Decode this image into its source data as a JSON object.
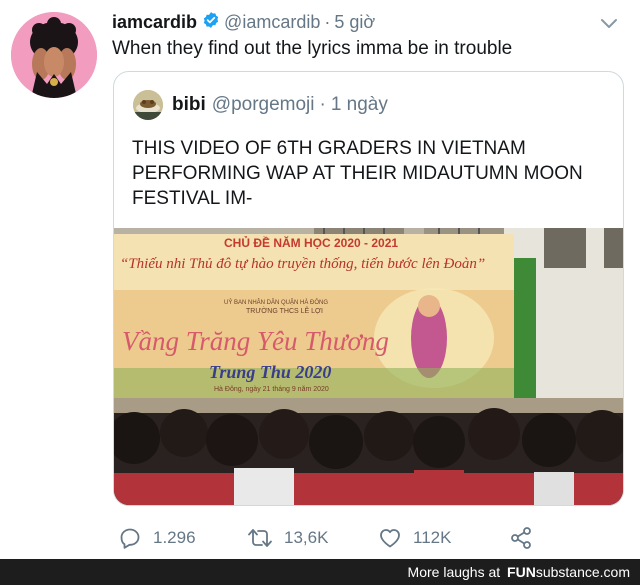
{
  "tweet": {
    "author_name": "iamcardib",
    "author_handle": "@iamcardib",
    "separator": "·",
    "time": "5 giờ",
    "text": "When they find out the lyrics imma be in trouble",
    "avatar_bg": "#f29cc0"
  },
  "quote": {
    "author_name": "bibi",
    "author_handle": "@porgemoji",
    "separator": "·",
    "time": "1 ngày",
    "text": "THIS VIDEO OF 6TH GRADERS IN VIETNAM PERFORMING WAP AT THEIR MIDAUTUMN MOON FESTIVAL IM-",
    "media": {
      "banner_title": "CHỦ ĐỀ NĂM HỌC 2020 - 2021",
      "banner_slogan": "“Thiếu nhi Thủ đô tự hào truyền thống, tiến bước lên Đoàn”",
      "org_line1": "UỶ BAN NHÂN DÂN QUẬN HÀ ĐÔNG",
      "org_line2": "TRƯỜNG THCS LÊ LỢI",
      "festival_title": "Vầng Trăng Yêu Thương",
      "festival_subtitle": "Trung Thu 2020",
      "place_date": "Hà Đông, ngày 21 tháng 9 năm 2020"
    }
  },
  "actions": {
    "replies": "1.296",
    "retweets": "13,6K",
    "likes": "112K"
  },
  "footer": {
    "text": "More laughs at",
    "brand_fun": "FUN",
    "brand_rest": "substance.com"
  },
  "colors": {
    "verified": "#1da1f2",
    "muted": "#657786",
    "footer_bg": "#1d1d1d"
  }
}
